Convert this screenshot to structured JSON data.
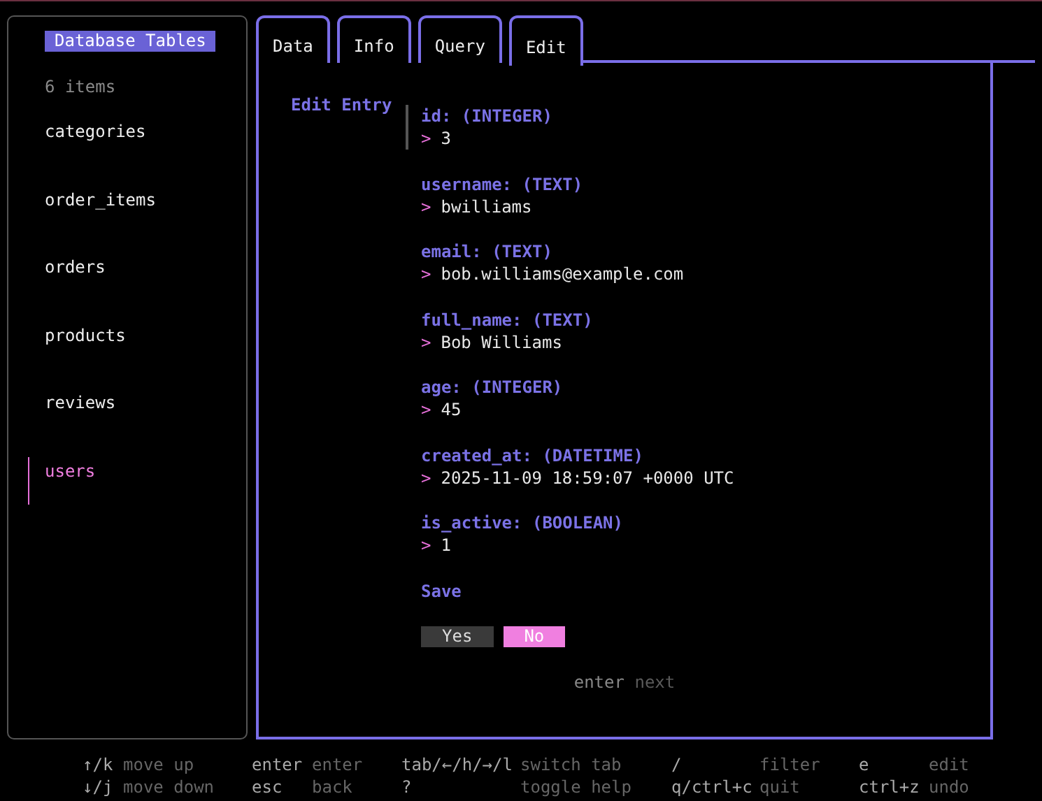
{
  "sidebar": {
    "title": "Database Tables",
    "count": "6 items",
    "items": [
      {
        "label": "categories",
        "selected": false
      },
      {
        "label": "order_items",
        "selected": false
      },
      {
        "label": "orders",
        "selected": false
      },
      {
        "label": "products",
        "selected": false
      },
      {
        "label": "reviews",
        "selected": false
      },
      {
        "label": "users",
        "selected": true
      }
    ]
  },
  "tabs": [
    {
      "label": "Data",
      "selected": false
    },
    {
      "label": "Info",
      "selected": false
    },
    {
      "label": "Query",
      "selected": false
    },
    {
      "label": "Edit",
      "selected": true
    }
  ],
  "form": {
    "title": "Edit Entry",
    "fields": [
      {
        "label": "id: (INTEGER)",
        "prompt": ">",
        "value": "3",
        "focused": true
      },
      {
        "label": "username: (TEXT)",
        "prompt": ">",
        "value": "bwilliams",
        "focused": false
      },
      {
        "label": "email: (TEXT)",
        "prompt": ">",
        "value": "bob.williams@example.com",
        "focused": false
      },
      {
        "label": "full_name: (TEXT)",
        "prompt": ">",
        "value": "Bob Williams",
        "focused": false
      },
      {
        "label": "age: (INTEGER)",
        "prompt": ">",
        "value": "45",
        "focused": false
      },
      {
        "label": "created_at: (DATETIME)",
        "prompt": ">",
        "value": "2025-11-09 18:59:07 +0000 UTC",
        "focused": false
      },
      {
        "label": "is_active: (BOOLEAN)",
        "prompt": ">",
        "value": "1",
        "focused": false
      }
    ],
    "save_label": "Save",
    "confirm": [
      {
        "label": "Yes",
        "selected": false
      },
      {
        "label": "No",
        "selected": true
      }
    ],
    "hint": {
      "key": "enter",
      "action": "next"
    }
  },
  "help": [
    [
      {
        "key": "↑/k",
        "desc": "move up"
      },
      {
        "key": "enter",
        "desc": "enter"
      },
      {
        "key": "tab/←/h/→/l",
        "desc": "switch tab"
      },
      {
        "key": "/",
        "desc": "filter"
      },
      {
        "key": "e",
        "desc": "edit"
      }
    ],
    [
      {
        "key": "↓/j",
        "desc": "move down"
      },
      {
        "key": "esc",
        "desc": "back"
      },
      {
        "key": "?",
        "desc": "toggle help"
      },
      {
        "key": "q/ctrl+c",
        "desc": "quit"
      },
      {
        "key": "ctrl+z",
        "desc": "undo"
      }
    ]
  ]
}
